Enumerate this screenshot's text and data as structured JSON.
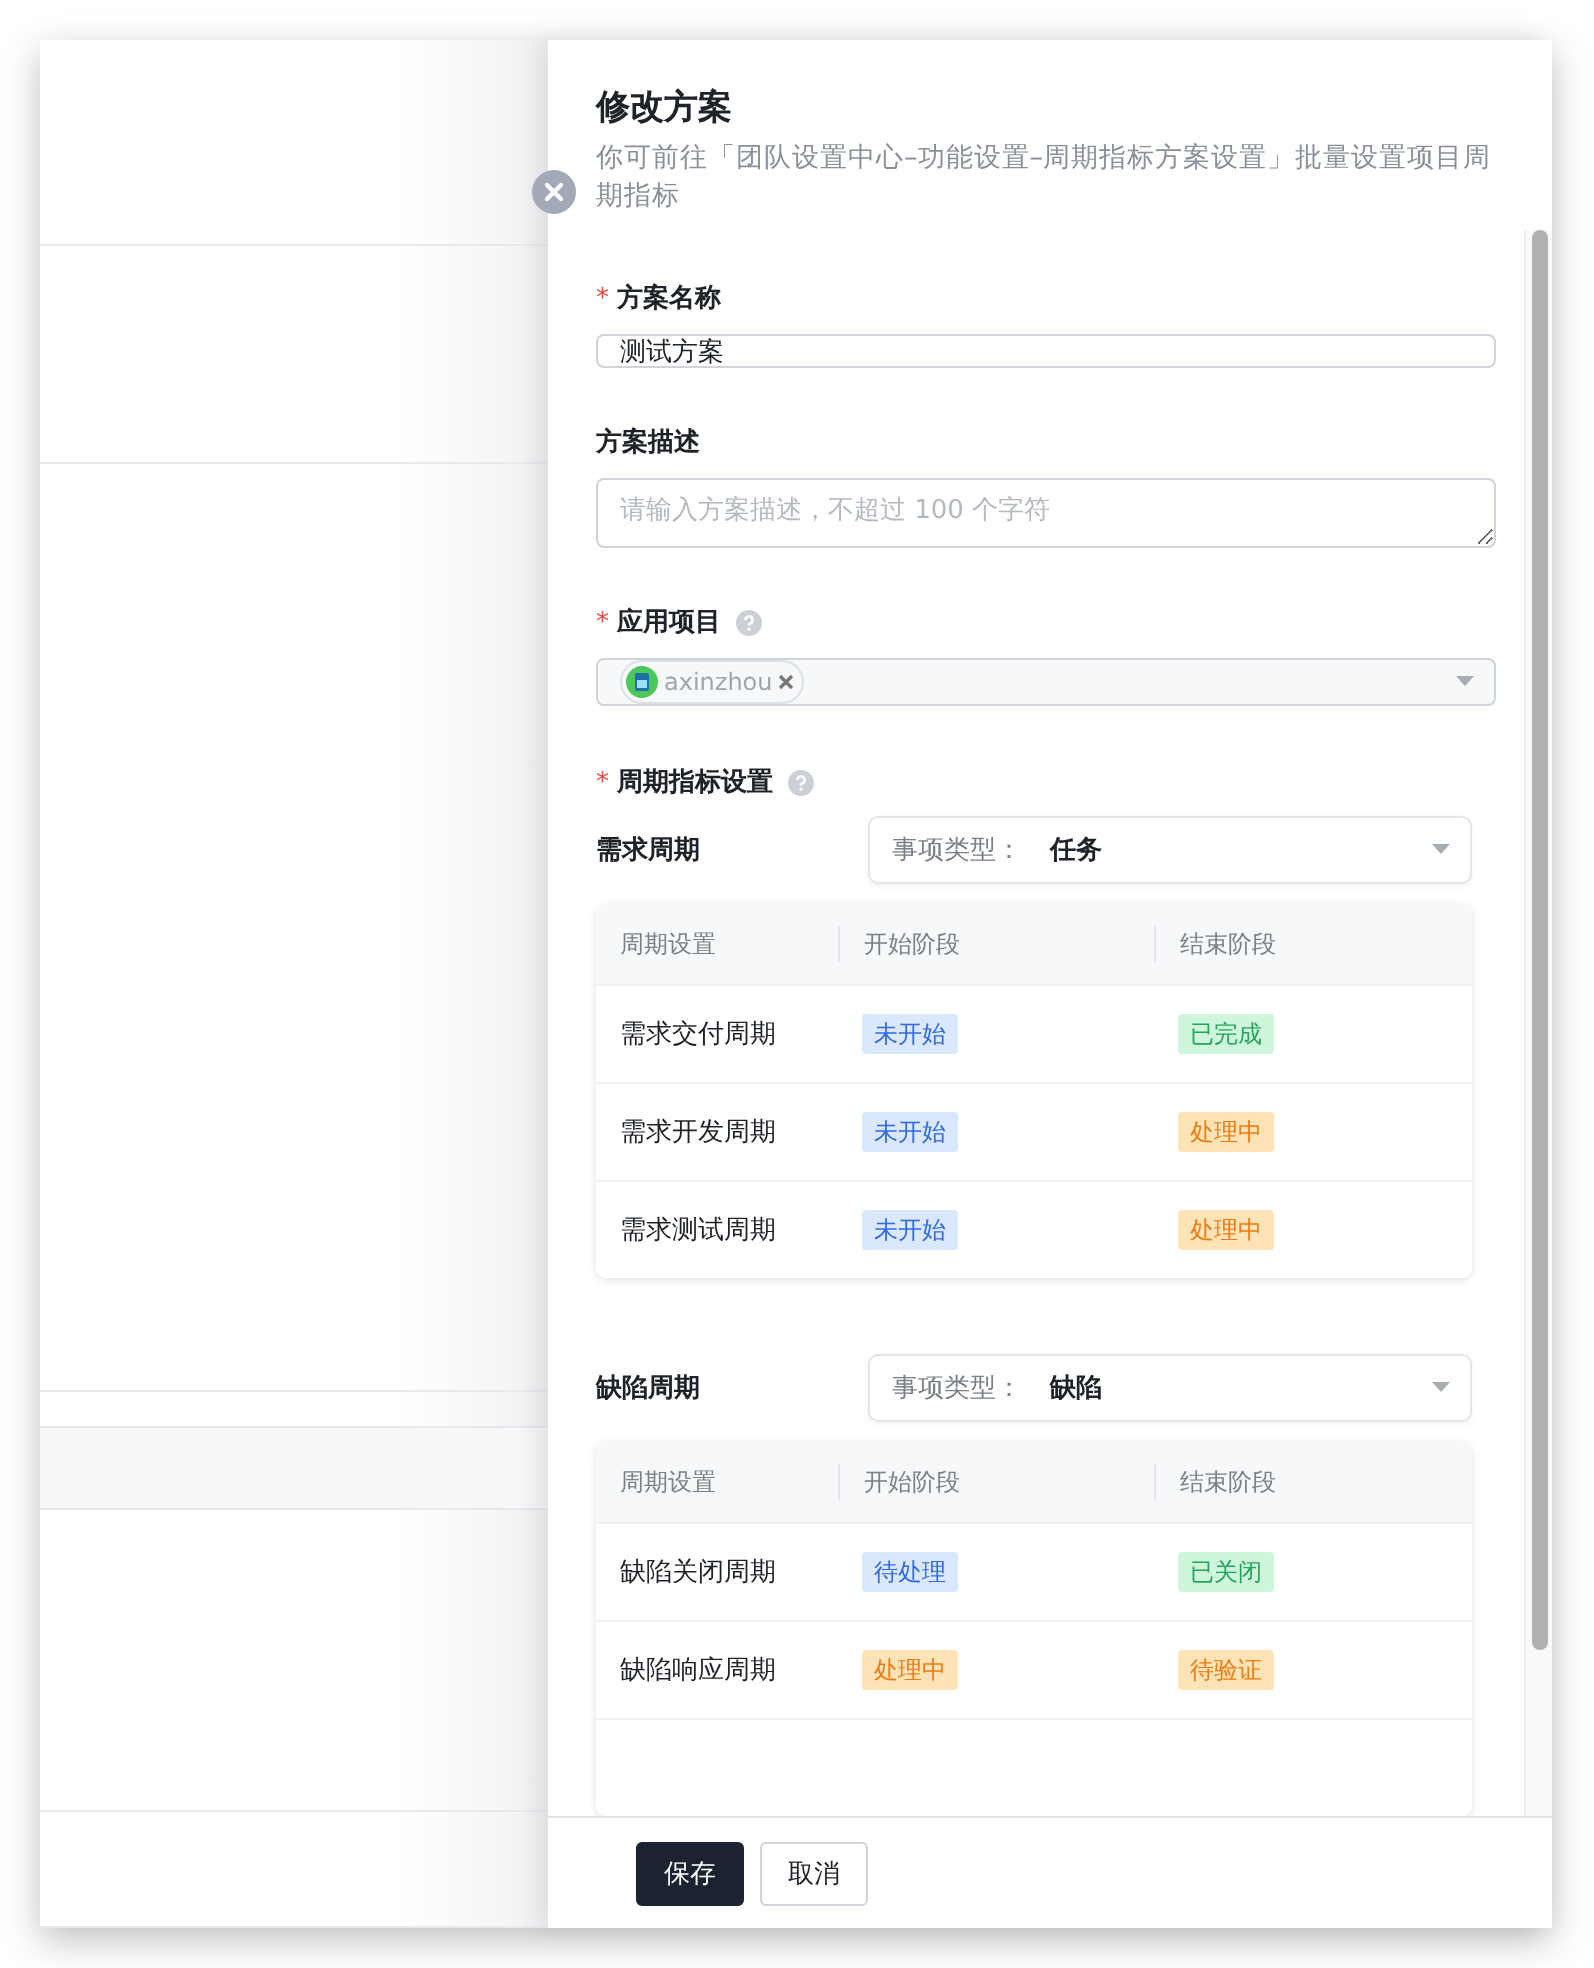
{
  "drawer": {
    "title": "修改方案",
    "subtitle": "你可前往「团队设置中心–功能设置–周期指标方案设置」批量设置项目周期指标",
    "fields": [
      {
        "kind": "input",
        "label": "方案名称",
        "required_mark": "*",
        "help": false,
        "value": "测试方案"
      },
      {
        "kind": "textarea",
        "label": "方案描述",
        "help": false,
        "placeholder": "请输入方案描述，不超过 100 个字符"
      },
      {
        "kind": "select",
        "label": "应用项目",
        "required_mark": "*",
        "help": true,
        "chips": [
          {
            "label": "axinzhou"
          }
        ]
      }
    ],
    "cycle_settings": {
      "label": "周期指标设置",
      "required_mark": "*",
      "help": true,
      "groups": [
        {
          "name": "需求周期",
          "type_label": "事项类型：",
          "type_value": "任务",
          "columns": [
            "周期设置",
            "开始阶段",
            "结束阶段"
          ],
          "rows": [
            {
              "name": "需求交付周期",
              "start": {
                "label": "未开始",
                "kind": "pending"
              },
              "end": {
                "label": "已完成",
                "kind": "done"
              }
            },
            {
              "name": "需求开发周期",
              "start": {
                "label": "未开始",
                "kind": "pending"
              },
              "end": {
                "label": "处理中",
                "kind": "active"
              }
            },
            {
              "name": "需求测试周期",
              "start": {
                "label": "未开始",
                "kind": "pending"
              },
              "end": {
                "label": "处理中",
                "kind": "active"
              }
            }
          ]
        },
        {
          "name": "缺陷周期",
          "type_label": "事项类型：",
          "type_value": "缺陷",
          "columns": [
            "周期设置",
            "开始阶段",
            "结束阶段"
          ],
          "rows": [
            {
              "name": "缺陷关闭周期",
              "start": {
                "label": "待处理",
                "kind": "pending"
              },
              "end": {
                "label": "已关闭",
                "kind": "done"
              }
            },
            {
              "name": "缺陷响应周期",
              "start": {
                "label": "处理中",
                "kind": "active"
              },
              "end": {
                "label": "待验证",
                "kind": "active"
              }
            }
          ]
        }
      ]
    },
    "buttons": [
      {
        "label": "保存",
        "kind": "primary"
      },
      {
        "label": "取消",
        "kind": "default"
      }
    ]
  }
}
